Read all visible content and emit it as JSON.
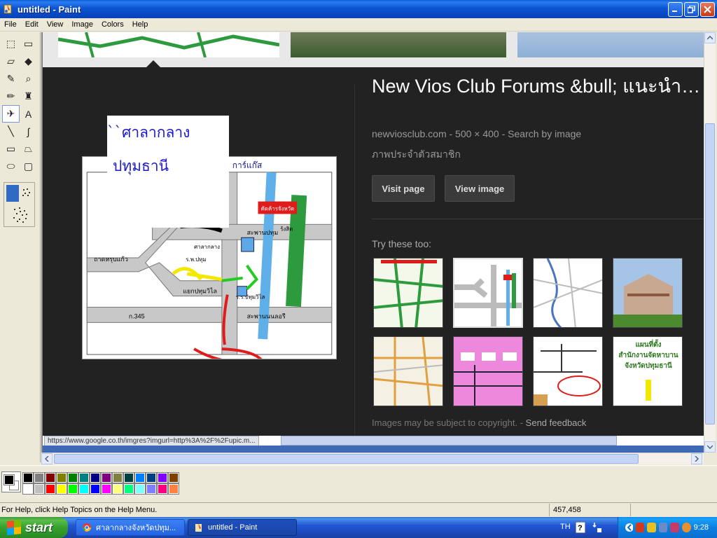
{
  "window": {
    "title": "untitled - Paint",
    "min_label": "_",
    "max_label": "❐",
    "close_label": "✕"
  },
  "menu": [
    "File",
    "Edit",
    "View",
    "Image",
    "Colors",
    "Help"
  ],
  "tools": [
    {
      "name": "free-form-select",
      "glyph": "⬚"
    },
    {
      "name": "select",
      "glyph": "▭"
    },
    {
      "name": "eraser",
      "glyph": "▱"
    },
    {
      "name": "fill-with-color",
      "glyph": "◆"
    },
    {
      "name": "pick-color",
      "glyph": "✎"
    },
    {
      "name": "magnifier",
      "glyph": "⌕"
    },
    {
      "name": "pencil",
      "glyph": "✏"
    },
    {
      "name": "brush",
      "glyph": "♜"
    },
    {
      "name": "airbrush",
      "glyph": "✈"
    },
    {
      "name": "text",
      "glyph": "A"
    },
    {
      "name": "line",
      "glyph": "╲"
    },
    {
      "name": "curve",
      "glyph": "∫"
    },
    {
      "name": "rectangle",
      "glyph": "▭"
    },
    {
      "name": "polygon",
      "glyph": "⏢"
    },
    {
      "name": "ellipse",
      "glyph": "⬭"
    },
    {
      "name": "rounded-rectangle",
      "glyph": "▢"
    }
  ],
  "canvas": {
    "info_title": "New Vios Club Forums &bull; แนะนำ…",
    "info_sub": "newviosclub.com - 500 × 400 - Search by image",
    "info_desc": "ภาพประจำตัวสมาชิก",
    "visit_page": "Visit page",
    "view_image": "View image",
    "try_these": "Try these too:",
    "copyright": "Images may be subject to copyright.",
    "copyright_sep": " - ",
    "feedback": "Send feedback",
    "status_url": "https://www.google.co.th/imgres?imgurl=http%3A%2F%2Fupic.m...",
    "thai_line1": "``ศาลากลาง",
    "thai_line2": "ปทุมธานี",
    "map_labels": {
      "top_right": "การ์แก๊ส",
      "road1": "ถาดหรุบแก้ว",
      "road2": "ก.345",
      "road3": "สะพานปทุม",
      "road4": "สะพานนนลอรี",
      "place1": "ศาลากลาง",
      "place2": "แยกปทุมวิไล",
      "place3": "ร.ร.ปทุมวิไล",
      "place4": "ร.พ.ปทุม",
      "place5": "ร้งสิต",
      "red_sign": "คัดค้ารจังหวัด"
    },
    "thumb6_title": "แผนที่ตั้ง",
    "thumb6_line2": "สำนักงานจัดหาบาน",
    "thumb6_line3": "จังหวัดปทุมธานี"
  },
  "palette": [
    "#000000",
    "#808080",
    "#800000",
    "#808000",
    "#008000",
    "#008080",
    "#000080",
    "#800080",
    "#808040",
    "#004040",
    "#0080ff",
    "#004080",
    "#8000ff",
    "#804000",
    "#ffffff",
    "#c0c0c0",
    "#ff0000",
    "#ffff00",
    "#00ff00",
    "#00ffff",
    "#0000ff",
    "#ff00ff",
    "#ffff80",
    "#00ff80",
    "#80ffff",
    "#8080ff",
    "#ff0080",
    "#ff8040"
  ],
  "status": {
    "help": "For Help, click Help Topics on the Help Menu.",
    "coords": "457,458"
  },
  "taskbar": {
    "start": "start",
    "task1": "ศาลากลางจังหวัดปทุม...",
    "task2": "untitled - Paint",
    "lang": "TH",
    "clock": "9:28"
  }
}
